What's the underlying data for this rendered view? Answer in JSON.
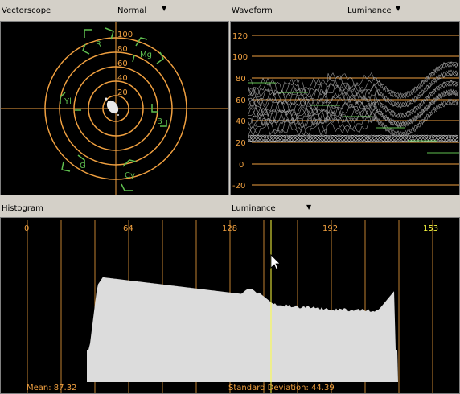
{
  "vectorscope": {
    "title": "Vectorscope",
    "mode": "Normal",
    "ring_labels": [
      "100",
      "80",
      "60",
      "40",
      "20"
    ],
    "targets": [
      "R",
      "Mg",
      "B",
      "Cy",
      "G",
      "Yl"
    ]
  },
  "waveform": {
    "title": "Waveform",
    "mode": "Luminance",
    "scale": [
      "120",
      "100",
      "80",
      "60",
      "40",
      "20",
      "0",
      "-20"
    ]
  },
  "histogram": {
    "title": "Histogram",
    "mode": "Luminance",
    "ticks": [
      "0",
      "64",
      "128",
      "192",
      "153"
    ],
    "mean": "Mean: 87.32",
    "std_dev": "Standard Deviation: 44.39",
    "marker_value": 153
  },
  "colors": {
    "scope_line": "#f0a040",
    "target": "#5fbf4f",
    "histogram_fill": "#dcdcdc",
    "marker": "#ffff40"
  }
}
